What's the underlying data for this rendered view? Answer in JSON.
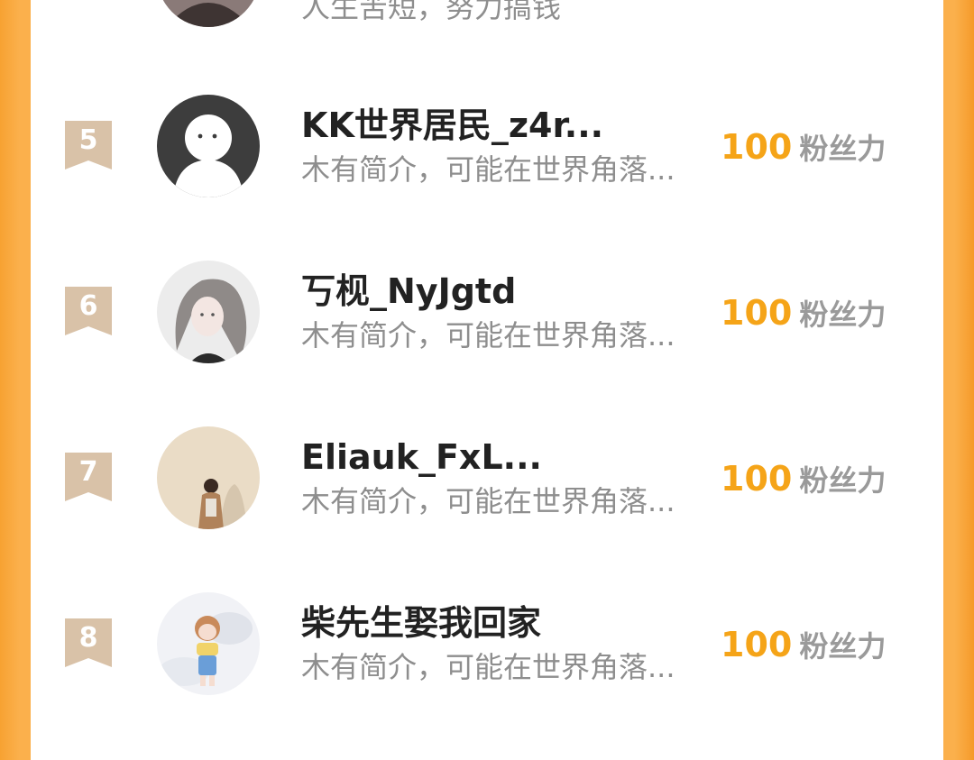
{
  "colors": {
    "background_orange": "#fbb04c",
    "rank_badge": "#d9c2a8",
    "power_number": "#f5a418",
    "name_text": "#222222",
    "bio_text": "#8e8e8e",
    "power_label": "#9a9a9a"
  },
  "rows": [
    {
      "rank": "",
      "name": "",
      "bio": "人生苦短，努力搞钱",
      "power_value": "",
      "power_label": "",
      "avatar_icon": "user-photo-avatar"
    },
    {
      "rank": "5",
      "name": "KK世界居民_z4r...",
      "bio": "木有简介，可能在世界角落...",
      "power_value": "100",
      "power_label": "粉丝力",
      "avatar_icon": "default-person-avatar-icon"
    },
    {
      "rank": "6",
      "name": "丂枧_NyJgtd",
      "bio": "木有简介，可能在世界角落...",
      "power_value": "100",
      "power_label": "粉丝力",
      "avatar_icon": "illustrated-girl-avatar"
    },
    {
      "rank": "7",
      "name": "Eliauk_FxL...",
      "bio": "木有简介，可能在世界角落...",
      "power_value": "100",
      "power_label": "粉丝力",
      "avatar_icon": "child-photo-avatar"
    },
    {
      "rank": "8",
      "name": "柴先生娶我回家",
      "bio": "木有简介，可能在世界角落...",
      "power_value": "100",
      "power_label": "粉丝力",
      "avatar_icon": "cartoon-girl-avatar"
    }
  ]
}
